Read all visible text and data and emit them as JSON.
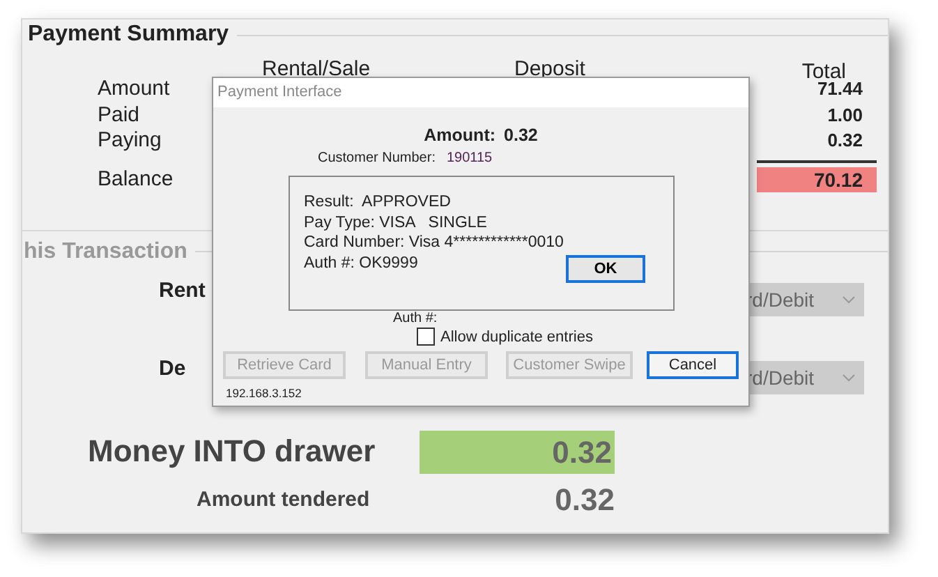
{
  "main": {
    "summary": {
      "title": "Payment Summary",
      "columns": [
        "Rental/Sale",
        "Deposit",
        "Total"
      ],
      "rows": [
        {
          "label": "Amount",
          "total": "71.44",
          "kind": "plain"
        },
        {
          "label": "Paid",
          "total": "1.00",
          "kind": "plain"
        },
        {
          "label": "Paying",
          "total": "0.32",
          "kind": "plain"
        },
        {
          "label": "Balance",
          "total": "70.12",
          "kind": "balance"
        }
      ]
    },
    "transaction": {
      "title": "his Transaction",
      "rows": [
        {
          "label": "Rent",
          "dropdown": "rd/Debit",
          "disabled": true
        },
        {
          "label": "De",
          "dropdown": "rd/Debit",
          "disabled": true
        }
      ],
      "money_into_drawer": {
        "label": "Money INTO drawer",
        "value": "0.32"
      },
      "amount_tendered": {
        "label": "Amount tendered",
        "value": "0.32"
      }
    }
  },
  "dialog": {
    "title": "Payment Interface",
    "amount_label": "Amount:",
    "amount": "0.32",
    "customer_label": "Customer Number:",
    "customer_number": "190115",
    "result": {
      "lines": [
        "Result:  APPROVED",
        "Pay Type: VISA   SINGLE",
        "Card Number: Visa 4************0010",
        "Auth #: OK9999"
      ],
      "ok": "OK"
    },
    "auth_label": "Auth #:",
    "allow_duplicates": {
      "label": "Allow duplicate entries",
      "checked": false
    },
    "buttons": [
      {
        "label": "Retrieve Card",
        "disabled": true
      },
      {
        "label": "Manual Entry",
        "disabled": true
      },
      {
        "label": "Customer Swipe",
        "disabled": true
      },
      {
        "label": "Cancel",
        "disabled": false
      }
    ],
    "ip": "192.168.3.152"
  }
}
